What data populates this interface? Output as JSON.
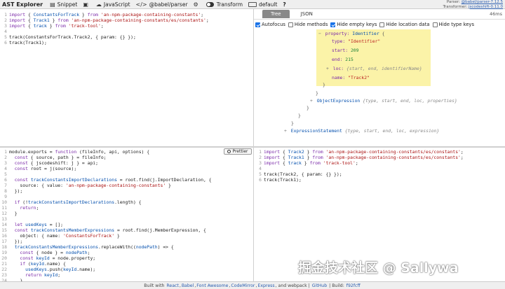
{
  "toolbar": {
    "title": "AST Explorer",
    "snippet_label": "Snippet",
    "language_label": "JavaScript",
    "parser_label": "@babel/parser",
    "transform_label": "Transform",
    "transformer_label": "default",
    "help_label": "?",
    "parser_version_label": "Parser:",
    "parser_version": "@babel/parser-7.12.5",
    "transformer_version_label": "Transformer:",
    "transformer_version": "jscodeshift-0.11.0"
  },
  "icons": {
    "snippet": "file-icon",
    "save": "save-icon",
    "cloud": "cloud-icon",
    "code": "code-icon",
    "settings": "gear-icon",
    "toggle": "toggle-icon",
    "keyboard": "keyboard-icon"
  },
  "source_code": [
    [
      {
        "t": "kw",
        "v": "import"
      },
      {
        "t": "plain",
        "v": " { "
      },
      {
        "t": "var",
        "v": "ConstantsForTrack"
      },
      {
        "t": "plain",
        "v": " } "
      },
      {
        "t": "kw",
        "v": "from"
      },
      {
        "t": "plain",
        "v": " "
      },
      {
        "t": "str",
        "v": "'an-npm-package-containing-constants'"
      },
      {
        "t": "plain",
        "v": ";"
      }
    ],
    [
      {
        "t": "kw",
        "v": "import"
      },
      {
        "t": "plain",
        "v": " { "
      },
      {
        "t": "var",
        "v": "Track1"
      },
      {
        "t": "plain",
        "v": " } "
      },
      {
        "t": "kw",
        "v": "from"
      },
      {
        "t": "plain",
        "v": " "
      },
      {
        "t": "str",
        "v": "'an-npm-package-containing-constants/es/constants'"
      },
      {
        "t": "plain",
        "v": ";"
      }
    ],
    [
      {
        "t": "kw",
        "v": "import"
      },
      {
        "t": "plain",
        "v": " { "
      },
      {
        "t": "var",
        "v": "track"
      },
      {
        "t": "plain",
        "v": " } "
      },
      {
        "t": "kw",
        "v": "from"
      },
      {
        "t": "plain",
        "v": " "
      },
      {
        "t": "str",
        "v": "'track-tool'"
      },
      {
        "t": "plain",
        "v": ";"
      }
    ],
    [],
    [
      {
        "t": "plain",
        "v": "track(ConstantsForTrack.Track2, { param: {} });"
      }
    ],
    [
      {
        "t": "plain",
        "v": "track(Track1);"
      }
    ]
  ],
  "tree_pane": {
    "tabs": [
      "Tree",
      "JSON"
    ],
    "elapsed": "46ms",
    "options": [
      {
        "label": "Autofocus",
        "checked": true
      },
      {
        "label": "Hide methods",
        "checked": false
      },
      {
        "label": "Hide empty keys",
        "checked": true
      },
      {
        "label": "Hide location data",
        "checked": false
      },
      {
        "label": "Hide type keys",
        "checked": false
      }
    ],
    "nodes": {
      "property_key": "property:",
      "property_type": "Identifier",
      "brace_open": "{",
      "type_key": "type:",
      "type_value": "\"Identifier\"",
      "start_key": "start:",
      "start_value": "209",
      "end_key": "end:",
      "end_value": "215",
      "loc_key": "loc:",
      "loc_meta": "{start, end, identifierName}",
      "name_key": "name:",
      "name_value": "\"Track2\"",
      "close_brace": "}",
      "object_expression": "ObjectExpression",
      "object_expression_meta": "{type, start, end, loc, properties}",
      "expression_statement": "ExpressionStatement",
      "expression_statement_meta": "{type, start, end, loc, expression}"
    }
  },
  "transform_code": [
    [
      {
        "t": "plain",
        "v": "module.exports = "
      },
      {
        "t": "kw",
        "v": "function"
      },
      {
        "t": "plain",
        "v": " (fileInfo, api, options) {"
      }
    ],
    [
      {
        "t": "plain",
        "v": "  "
      },
      {
        "t": "kw",
        "v": "const"
      },
      {
        "t": "plain",
        "v": " { source, path } = fileInfo;"
      }
    ],
    [
      {
        "t": "plain",
        "v": "  "
      },
      {
        "t": "kw",
        "v": "const"
      },
      {
        "t": "plain",
        "v": " { jscodeshift: j } = api;"
      }
    ],
    [
      {
        "t": "plain",
        "v": "  "
      },
      {
        "t": "kw",
        "v": "const"
      },
      {
        "t": "plain",
        "v": " root = j(source);"
      }
    ],
    [],
    [
      {
        "t": "plain",
        "v": "  "
      },
      {
        "t": "kw",
        "v": "const"
      },
      {
        "t": "plain",
        "v": " "
      },
      {
        "t": "var",
        "v": "trackConstantsImportDeclarations"
      },
      {
        "t": "plain",
        "v": " = root.find(j.ImportDeclaration, {"
      }
    ],
    [
      {
        "t": "plain",
        "v": "    source: { value: "
      },
      {
        "t": "str",
        "v": "'an-npm-package-containing-constants'"
      },
      {
        "t": "plain",
        "v": " }"
      }
    ],
    [
      {
        "t": "plain",
        "v": "  });"
      }
    ],
    [],
    [
      {
        "t": "plain",
        "v": "  "
      },
      {
        "t": "kw",
        "v": "if"
      },
      {
        "t": "plain",
        "v": " (!"
      },
      {
        "t": "var",
        "v": "trackConstantsImportDeclarations"
      },
      {
        "t": "plain",
        "v": ".length) {"
      }
    ],
    [
      {
        "t": "plain",
        "v": "    "
      },
      {
        "t": "kw",
        "v": "return"
      },
      {
        "t": "plain",
        "v": ";"
      }
    ],
    [
      {
        "t": "plain",
        "v": "  }"
      }
    ],
    [],
    [
      {
        "t": "plain",
        "v": "  "
      },
      {
        "t": "kw",
        "v": "let"
      },
      {
        "t": "plain",
        "v": " "
      },
      {
        "t": "var",
        "v": "usedKeys"
      },
      {
        "t": "plain",
        "v": " = [];"
      }
    ],
    [
      {
        "t": "plain",
        "v": "  "
      },
      {
        "t": "kw",
        "v": "const"
      },
      {
        "t": "plain",
        "v": " "
      },
      {
        "t": "var",
        "v": "trackConstantsMemberExpressions"
      },
      {
        "t": "plain",
        "v": " = root.find(j.MemberExpression, {"
      }
    ],
    [
      {
        "t": "plain",
        "v": "    object: { name: "
      },
      {
        "t": "str",
        "v": "'ConstantsForTrack'"
      },
      {
        "t": "plain",
        "v": " }"
      }
    ],
    [
      {
        "t": "plain",
        "v": "  });"
      }
    ],
    [
      {
        "t": "plain",
        "v": "  "
      },
      {
        "t": "var",
        "v": "trackConstantsMemberExpressions"
      },
      {
        "t": "plain",
        "v": ".replaceWith(("
      },
      {
        "t": "var",
        "v": "nodePath"
      },
      {
        "t": "plain",
        "v": ") => {"
      }
    ],
    [
      {
        "t": "plain",
        "v": "    "
      },
      {
        "t": "kw",
        "v": "const"
      },
      {
        "t": "plain",
        "v": " { node } = "
      },
      {
        "t": "var",
        "v": "nodePath"
      },
      {
        "t": "plain",
        "v": ";"
      }
    ],
    [
      {
        "t": "plain",
        "v": "    "
      },
      {
        "t": "kw",
        "v": "const"
      },
      {
        "t": "plain",
        "v": " "
      },
      {
        "t": "var",
        "v": "keyId"
      },
      {
        "t": "plain",
        "v": " = node.property;"
      }
    ],
    [
      {
        "t": "plain",
        "v": "    "
      },
      {
        "t": "kw",
        "v": "if"
      },
      {
        "t": "plain",
        "v": " ("
      },
      {
        "t": "var",
        "v": "keyId"
      },
      {
        "t": "plain",
        "v": ".name) {"
      }
    ],
    [
      {
        "t": "plain",
        "v": "      "
      },
      {
        "t": "var",
        "v": "usedKeys"
      },
      {
        "t": "plain",
        "v": ".push("
      },
      {
        "t": "var",
        "v": "keyId"
      },
      {
        "t": "plain",
        "v": ".name);"
      }
    ],
    [
      {
        "t": "plain",
        "v": "      "
      },
      {
        "t": "kw",
        "v": "return"
      },
      {
        "t": "plain",
        "v": " "
      },
      {
        "t": "var",
        "v": "keyId"
      },
      {
        "t": "plain",
        "v": ";"
      }
    ],
    [
      {
        "t": "plain",
        "v": "    }"
      }
    ]
  ],
  "prettier_label": "Prettier",
  "output_code": [
    [
      {
        "t": "kw",
        "v": "import"
      },
      {
        "t": "plain",
        "v": " { "
      },
      {
        "t": "var",
        "v": "Track2"
      },
      {
        "t": "plain",
        "v": " } "
      },
      {
        "t": "kw",
        "v": "from"
      },
      {
        "t": "plain",
        "v": " "
      },
      {
        "t": "str",
        "v": "'an-npm-package-containing-constants/es/constants'"
      },
      {
        "t": "plain",
        "v": ";"
      }
    ],
    [
      {
        "t": "kw",
        "v": "import"
      },
      {
        "t": "plain",
        "v": " { "
      },
      {
        "t": "var",
        "v": "Track1"
      },
      {
        "t": "plain",
        "v": " } "
      },
      {
        "t": "kw",
        "v": "from"
      },
      {
        "t": "plain",
        "v": " "
      },
      {
        "t": "str",
        "v": "'an-npm-package-containing-constants/es/constants'"
      },
      {
        "t": "plain",
        "v": ";"
      }
    ],
    [
      {
        "t": "kw",
        "v": "import"
      },
      {
        "t": "plain",
        "v": " { "
      },
      {
        "t": "var",
        "v": "track"
      },
      {
        "t": "plain",
        "v": " } "
      },
      {
        "t": "kw",
        "v": "from"
      },
      {
        "t": "plain",
        "v": " "
      },
      {
        "t": "str",
        "v": "'track-tool'"
      },
      {
        "t": "plain",
        "v": ";"
      }
    ],
    [],
    [
      {
        "t": "plain",
        "v": "track(Track2, { param: {} });"
      }
    ],
    [
      {
        "t": "plain",
        "v": "track(Track1);"
      }
    ]
  ],
  "footer": {
    "prefix": "Built with",
    "links": [
      "React",
      "Babel",
      "Font Awesome",
      "CodeMirror",
      "Express"
    ],
    "and": "and",
    "webpack": "webpack",
    "github": "GitHub",
    "build_label": "Build:",
    "build": "f92fcff"
  },
  "watermark": "掘金技术社区 @ Sallywa"
}
